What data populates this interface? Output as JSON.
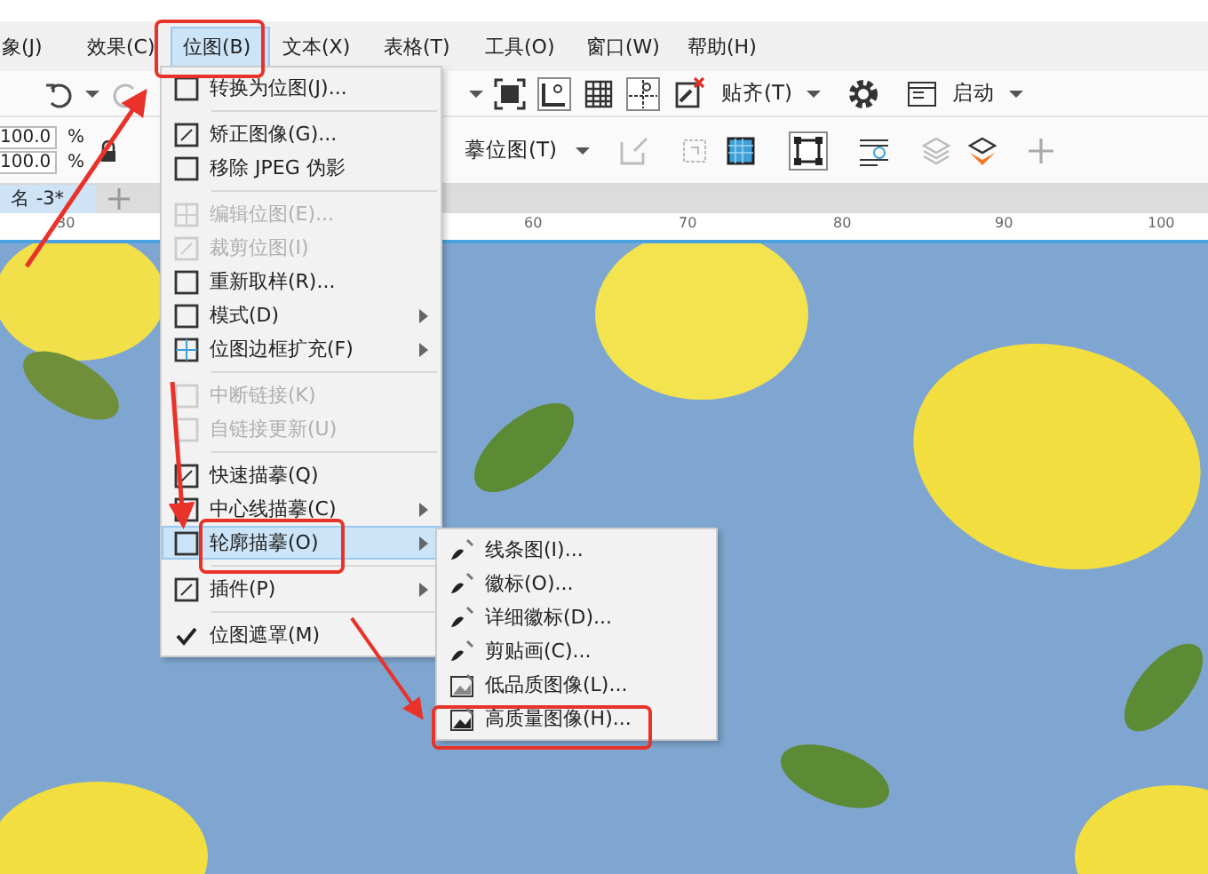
{
  "menubar": {
    "items": [
      {
        "label": "象(J)",
        "selected": false
      },
      {
        "label": "效果(C)",
        "selected": false
      },
      {
        "label": "位图(B)",
        "selected": true
      },
      {
        "label": "文本(X)",
        "selected": false
      },
      {
        "label": "表格(T)",
        "selected": false
      },
      {
        "label": "工具(O)",
        "selected": false
      },
      {
        "label": "窗口(W)",
        "selected": false
      },
      {
        "label": "帮助(H)",
        "selected": false
      }
    ]
  },
  "toolbar": {
    "snap_label": "贴齐(T)",
    "launch_label": "启动"
  },
  "property_bar": {
    "fields": [
      {
        "value": "100.0",
        "unit": "%"
      },
      {
        "value": "100.0",
        "unit": "%"
      }
    ],
    "trace_label": "摹位图(T)"
  },
  "document_tab": {
    "label": "名 -3*"
  },
  "ruler": {
    "labels": [
      "30",
      "60",
      "70",
      "80",
      "90",
      "100"
    ]
  },
  "bitmap_menu": {
    "items": [
      {
        "kind": "item",
        "label": "转换为位图(J)...",
        "disabled": false,
        "submenu": false,
        "selected": false,
        "checked": false
      },
      {
        "kind": "separator"
      },
      {
        "kind": "item",
        "label": "矫正图像(G)...",
        "disabled": false,
        "submenu": false,
        "selected": false,
        "checked": false
      },
      {
        "kind": "item",
        "label": "移除 JPEG 伪影",
        "disabled": false,
        "submenu": false,
        "selected": false,
        "checked": false
      },
      {
        "kind": "separator"
      },
      {
        "kind": "item",
        "label": "编辑位图(E)...",
        "disabled": true,
        "submenu": false,
        "selected": false,
        "checked": false
      },
      {
        "kind": "item",
        "label": "裁剪位图(I)",
        "disabled": true,
        "submenu": false,
        "selected": false,
        "checked": false
      },
      {
        "kind": "item",
        "label": "重新取样(R)...",
        "disabled": false,
        "submenu": false,
        "selected": false,
        "checked": false
      },
      {
        "kind": "item",
        "label": "模式(D)",
        "disabled": false,
        "submenu": true,
        "selected": false,
        "checked": false
      },
      {
        "kind": "item",
        "label": "位图边框扩充(F)",
        "disabled": false,
        "submenu": true,
        "selected": false,
        "checked": false
      },
      {
        "kind": "separator"
      },
      {
        "kind": "item",
        "label": "中断链接(K)",
        "disabled": true,
        "submenu": false,
        "selected": false,
        "checked": false
      },
      {
        "kind": "item",
        "label": "自链接更新(U)",
        "disabled": true,
        "submenu": false,
        "selected": false,
        "checked": false
      },
      {
        "kind": "separator"
      },
      {
        "kind": "item",
        "label": "快速描摹(Q)",
        "disabled": false,
        "submenu": false,
        "selected": false,
        "checked": false
      },
      {
        "kind": "item",
        "label": "中心线描摹(C)",
        "disabled": false,
        "submenu": true,
        "selected": false,
        "checked": false
      },
      {
        "kind": "item",
        "label": "轮廓描摹(O)",
        "disabled": false,
        "submenu": true,
        "selected": true,
        "checked": false
      },
      {
        "kind": "separator"
      },
      {
        "kind": "item",
        "label": "插件(P)",
        "disabled": false,
        "submenu": true,
        "selected": false,
        "checked": false
      },
      {
        "kind": "separator"
      },
      {
        "kind": "item",
        "label": "位图遮罩(M)",
        "disabled": false,
        "submenu": false,
        "selected": false,
        "checked": true
      }
    ]
  },
  "outline_submenu": {
    "items": [
      {
        "label": "线条图(I)...",
        "selected": false
      },
      {
        "label": "徽标(O)...",
        "selected": false
      },
      {
        "label": "详细徽标(D)...",
        "selected": false
      },
      {
        "label": "剪贴画(C)...",
        "selected": false
      },
      {
        "label": "低品质图像(L)...",
        "selected": false
      },
      {
        "label": "高质量图像(H)...",
        "selected": false
      }
    ]
  }
}
